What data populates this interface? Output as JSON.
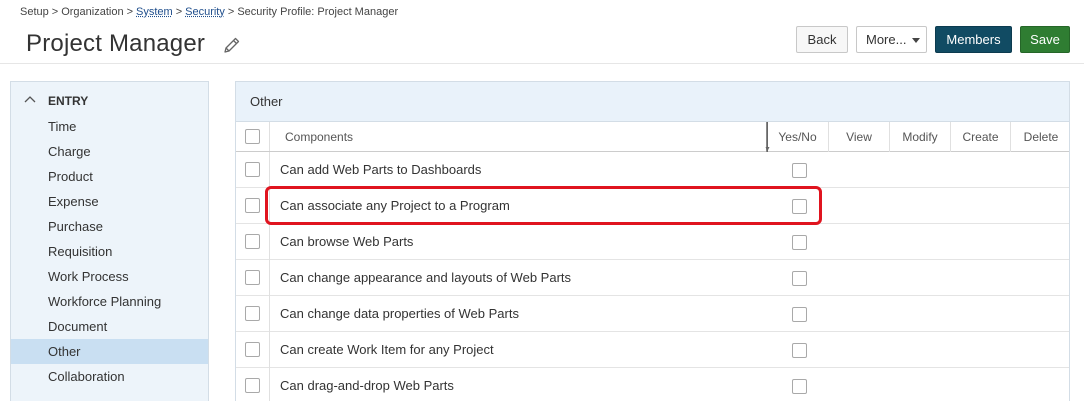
{
  "breadcrumb": {
    "setup": "Setup",
    "organization": "Organization",
    "system": "System",
    "security": "Security",
    "current": "Security Profile: Project Manager",
    "sep": ">"
  },
  "title": "Project Manager",
  "buttons": {
    "back": "Back",
    "more": "More...",
    "members": "Members",
    "save": "Save"
  },
  "sidebar": {
    "group": "ENTRY",
    "items": [
      {
        "label": "Time"
      },
      {
        "label": "Charge"
      },
      {
        "label": "Product"
      },
      {
        "label": "Expense"
      },
      {
        "label": "Purchase"
      },
      {
        "label": "Requisition"
      },
      {
        "label": "Work Process"
      },
      {
        "label": "Workforce Planning"
      },
      {
        "label": "Document"
      },
      {
        "label": "Other"
      },
      {
        "label": "Collaboration"
      }
    ],
    "active": "Other"
  },
  "panel": {
    "title": "Other",
    "columns": {
      "components": "Components",
      "yesno": "Yes/No",
      "view": "View",
      "modify": "Modify",
      "create": "Create",
      "delete": "Delete"
    },
    "rows": [
      {
        "label": "Can add Web Parts to Dashboards",
        "yes": false
      },
      {
        "label": "Can associate any Project to a Program",
        "yes": false
      },
      {
        "label": "Can browse Web Parts",
        "yes": false
      },
      {
        "label": "Can change appearance and layouts of Web Parts",
        "yes": false
      },
      {
        "label": "Can change data properties of Web Parts",
        "yes": false
      },
      {
        "label": "Can create Work Item for any Project",
        "yes": false
      },
      {
        "label": "Can drag-and-drop Web Parts",
        "yes": false
      }
    ]
  },
  "colors": {
    "members_button": "#114b63",
    "save_button": "#2f7d32",
    "highlight": "#e0141f",
    "active_sidebar": "#c9dff2"
  }
}
